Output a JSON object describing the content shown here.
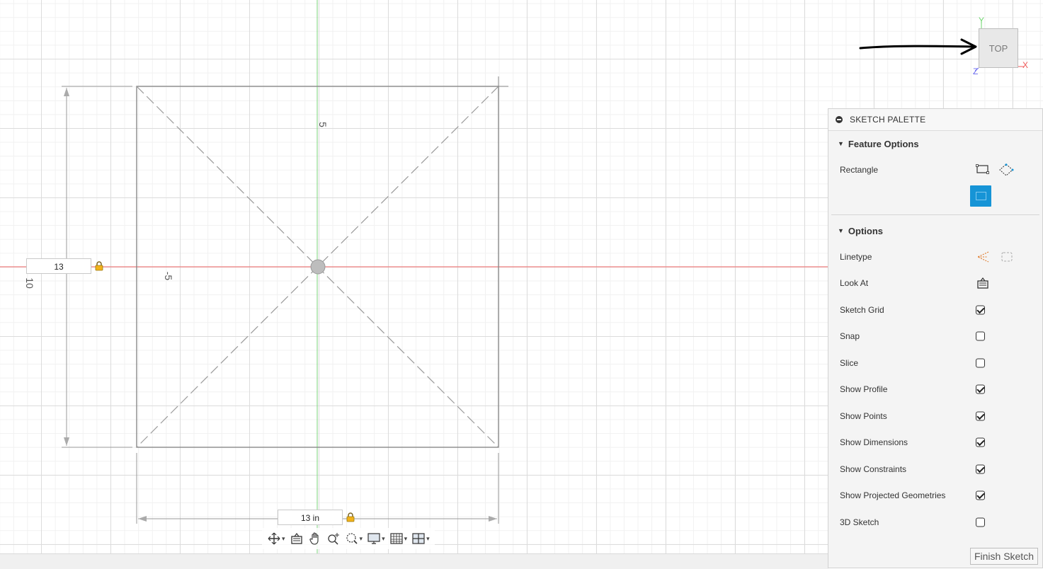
{
  "dimensions": {
    "height_input": "13",
    "width_input": "13 in",
    "side_dimension_text": "10",
    "axis_label_top": "5",
    "axis_label_left": "-5"
  },
  "viewcube": {
    "face_label": "TOP",
    "axis_y": "Y",
    "axis_x": "X",
    "axis_z": "Z",
    "colors": {
      "x": "#f05a5a",
      "y": "#6fd66f",
      "z": "#6b6bf0"
    }
  },
  "palette": {
    "title": "SKETCH PALETTE",
    "feature_options": {
      "heading": "Feature Options",
      "rectangle_label": "Rectangle"
    },
    "options": {
      "heading": "Options",
      "linetype_label": "Linetype",
      "lookat_label": "Look At",
      "checkboxes": [
        {
          "label": "Sketch Grid",
          "checked": true
        },
        {
          "label": "Snap",
          "checked": false
        },
        {
          "label": "Slice",
          "checked": false
        },
        {
          "label": "Show Profile",
          "checked": true
        },
        {
          "label": "Show Points",
          "checked": true
        },
        {
          "label": "Show Dimensions",
          "checked": true
        },
        {
          "label": "Show Constraints",
          "checked": true
        },
        {
          "label": "Show Projected Geometries",
          "checked": true
        },
        {
          "label": "3D Sketch",
          "checked": false
        }
      ]
    },
    "finish_label": "Finish Sketch"
  },
  "navbar": {
    "items": [
      "orbit-icon",
      "look-at-icon",
      "pan-icon",
      "zoom-icon",
      "fit-icon",
      "display-settings-icon",
      "grid-settings-icon",
      "viewports-icon"
    ]
  },
  "accent_colors": {
    "x_axis": "#f08080",
    "y_axis": "#8fdc8f",
    "active_tool": "#1694d6"
  }
}
